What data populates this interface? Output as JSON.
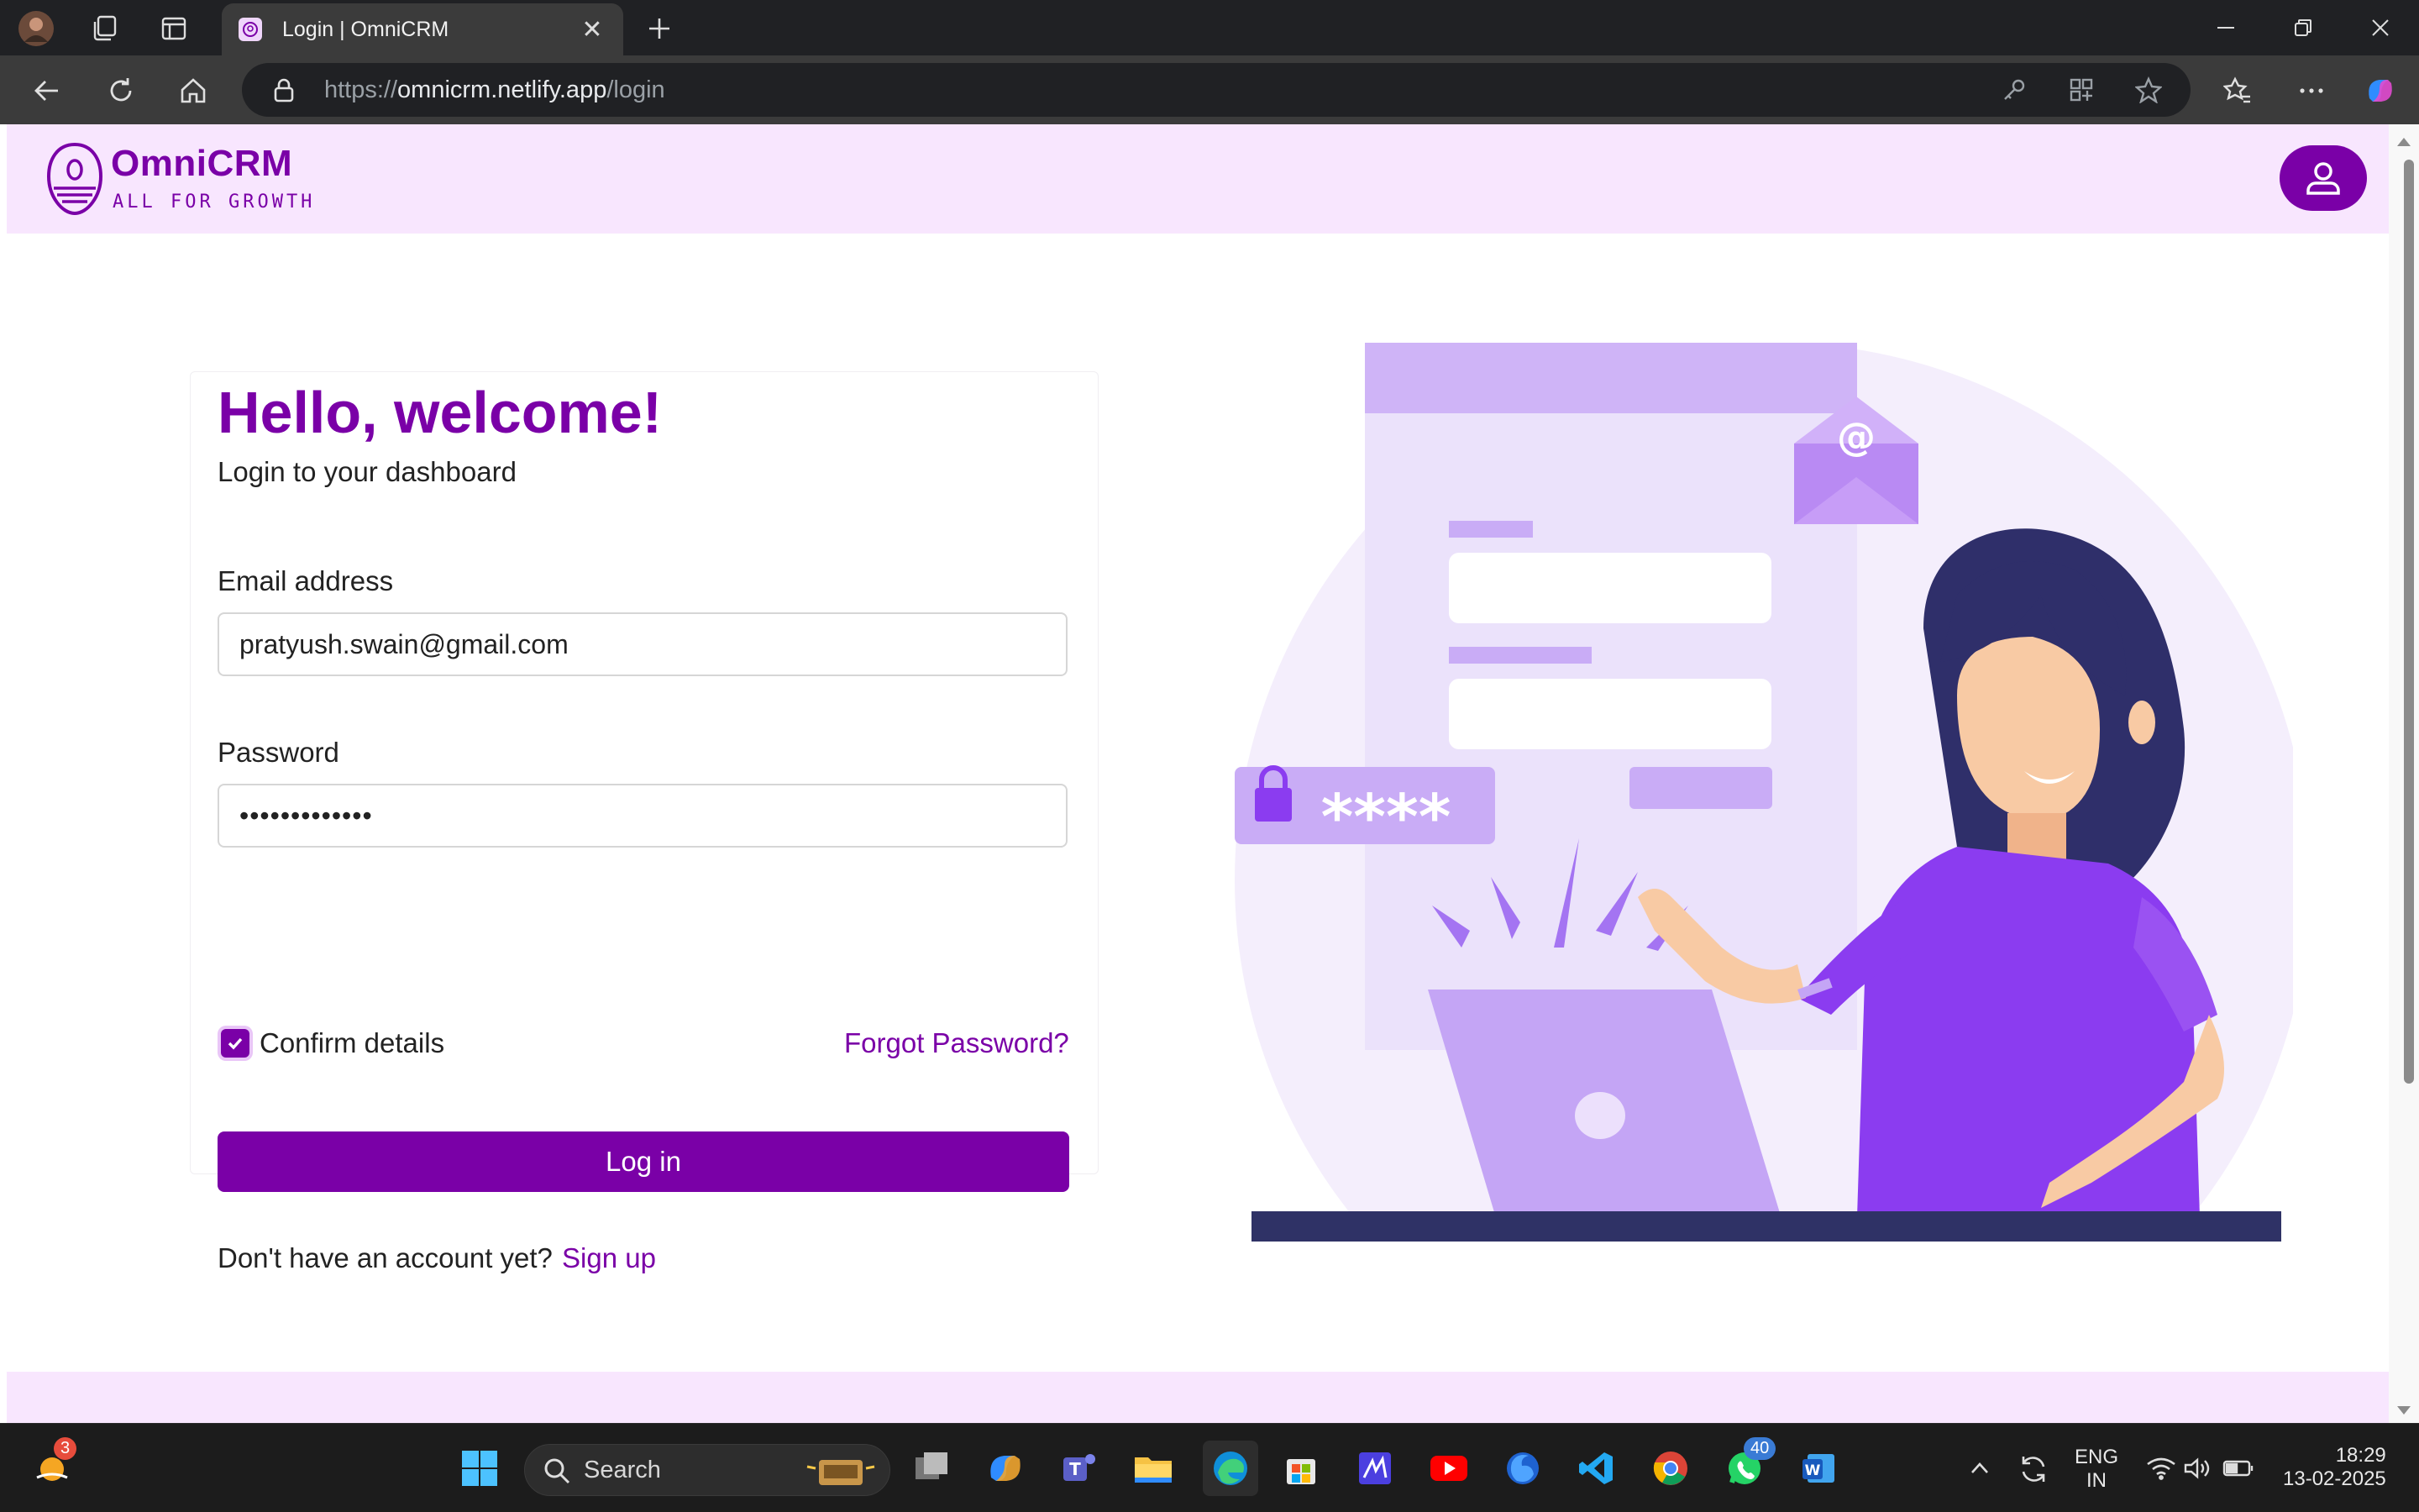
{
  "browser": {
    "tab_title": "Login | OmniCRM",
    "url_scheme": "https://",
    "url_host": "omnicrm.netlify.app",
    "url_path": "/login"
  },
  "site": {
    "brand_name": "OmniCRM",
    "brand_tagline": "ALL FOR GROWTH",
    "brand_color": "#7a00a7",
    "header_bg": "#f8e6fe"
  },
  "login": {
    "title": "Hello, welcome!",
    "subtitle": "Login to your dashboard",
    "email_label": "Email address",
    "email_value": "pratyush.swain@gmail.com",
    "password_label": "Password",
    "password_value": "•••••••••••••",
    "confirm_label": "Confirm details",
    "confirm_checked": true,
    "forgot_label": "Forgot Password?",
    "login_button": "Log in",
    "no_account_text": "Don't have an account yet?",
    "signup_label": "Sign up"
  },
  "illustration": {
    "password_mask": "****",
    "email_glyph": "@"
  },
  "taskbar": {
    "search_placeholder": "Search",
    "weather_badge": "3",
    "whatsapp_badge": "40",
    "lang_line1": "ENG",
    "lang_line2": "IN",
    "time": "18:29",
    "date": "13-02-2025"
  }
}
